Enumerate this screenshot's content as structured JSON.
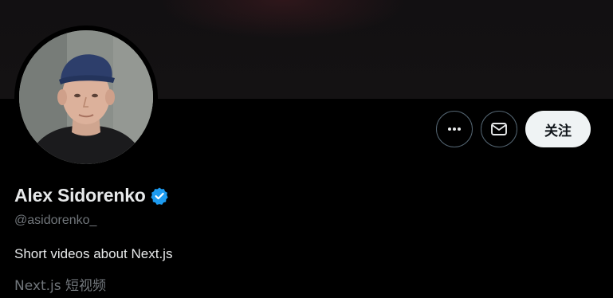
{
  "profile": {
    "display_name": "Alex Sidorenko",
    "handle": "@asidorenko_",
    "bio": "Short videos about Next.js",
    "bio_translation": "Next.js 短视频",
    "verified": true
  },
  "actions": {
    "follow_label": "关注",
    "more_icon": "more-horizontal-icon",
    "message_icon": "envelope-icon"
  },
  "colors": {
    "background": "#000000",
    "verified_blue": "#1d9bf0",
    "follow_button_bg": "#eff3f4",
    "muted_text": "#71767b",
    "primary_text": "#e7e9ea"
  }
}
